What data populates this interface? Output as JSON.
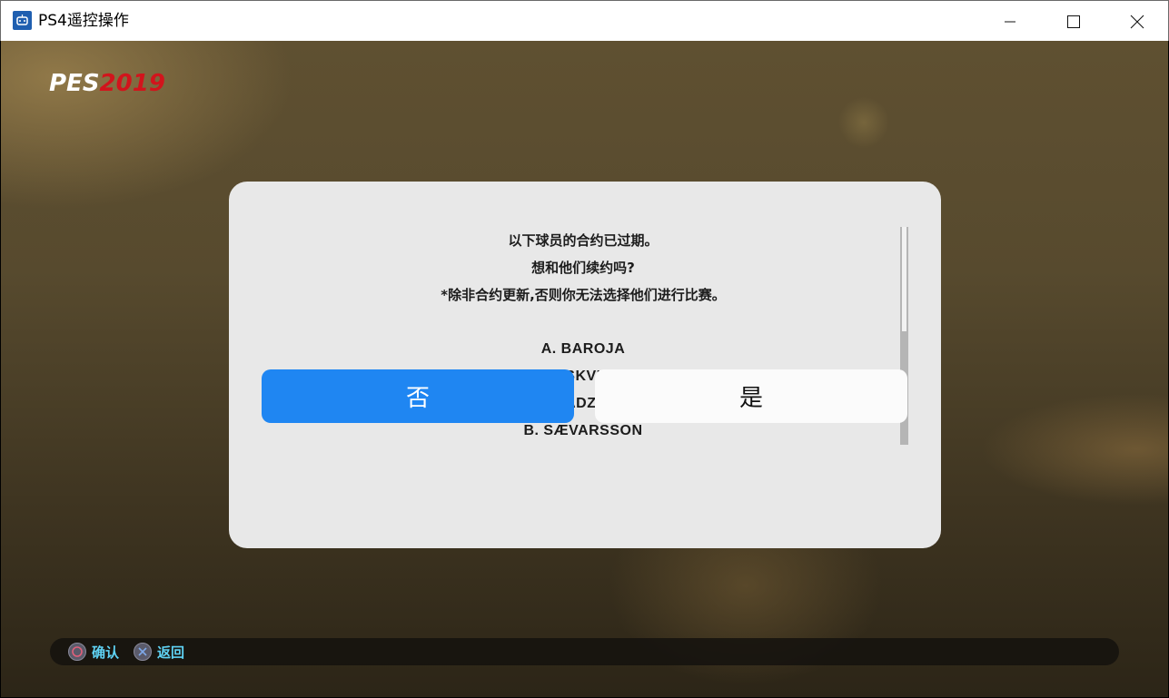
{
  "window": {
    "title": "PS4遥控操作",
    "icon": "remote-play-icon",
    "controls": [
      "minimize-icon",
      "maximize-icon",
      "close-icon"
    ]
  },
  "game": {
    "logo_pes": "PES",
    "logo_year": "2019"
  },
  "dialog": {
    "lines": [
      "以下球员的合约已过期。",
      "想和他们续约吗?",
      "*除非合约更新,否则你无法选择他们进行比赛。"
    ],
    "players": [
      "A. BAROJA",
      "V. MOSKVICHEV",
      "K. HADZHIEV",
      "B. SÆVARSSON"
    ],
    "no_label": "否",
    "yes_label": "是",
    "colors": {
      "primary": "#1f86f2",
      "panel": "#e8e8e8"
    }
  },
  "hints": {
    "confirm_label": "确认",
    "back_label": "返回",
    "confirm_icon": "circle-button-icon",
    "back_icon": "cross-button-icon"
  }
}
